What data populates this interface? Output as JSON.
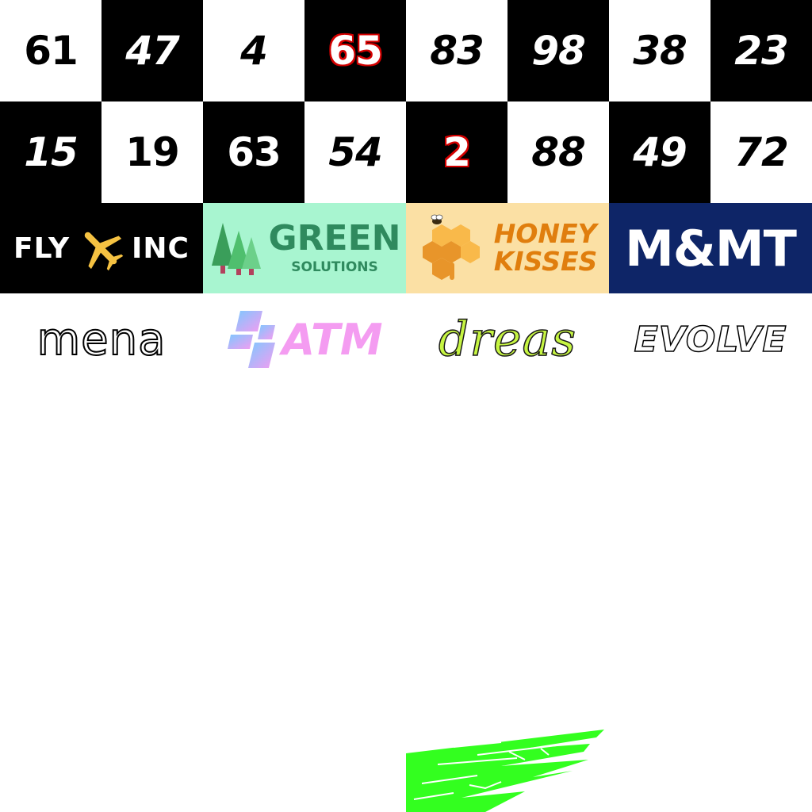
{
  "grid": {
    "rows": [
      [
        {
          "label": "61",
          "style": "light"
        },
        {
          "label": "47",
          "style": "dark",
          "italic": true
        },
        {
          "label": "4",
          "style": "light",
          "italic": true
        },
        {
          "label": "65",
          "style": "dark",
          "accent": true
        },
        {
          "label": "83",
          "style": "light",
          "italic": true
        },
        {
          "label": "98",
          "style": "dark",
          "italic": true
        },
        {
          "label": "38",
          "style": "light",
          "italic": true
        },
        {
          "label": "23",
          "style": "dark",
          "italic": true
        }
      ],
      [
        {
          "label": "15",
          "style": "dark",
          "italic": true
        },
        {
          "label": "19",
          "style": "light"
        },
        {
          "label": "63",
          "style": "dark"
        },
        {
          "label": "54",
          "style": "light",
          "italic": true
        },
        {
          "label": "2",
          "style": "dark",
          "accent": true
        },
        {
          "label": "88",
          "style": "light",
          "italic": true
        },
        {
          "label": "49",
          "style": "dark",
          "italic": true
        },
        {
          "label": "72",
          "style": "light",
          "italic": true
        }
      ]
    ]
  },
  "banners": {
    "fly": {
      "left": "FLY",
      "right": "INC",
      "icon": "airplane-icon"
    },
    "green": {
      "title": "GREEN",
      "subtitle": "SOLUTIONS",
      "icon": "pine-trees-icon"
    },
    "honey": {
      "line1": "HONEY",
      "line2": "KISSES",
      "icon": "honeycomb-bee-icon"
    },
    "mmt": {
      "title": "M&MT"
    }
  },
  "logos": {
    "mena": "mena",
    "atm": {
      "text": "ATM",
      "icon": "gradient-blocks-icon"
    },
    "dreas": "dreas",
    "evolve": "EVOLVE"
  },
  "colors": {
    "accent_red": "#d40000",
    "green_banner_bg": "#a8f5d0",
    "honey_banner_bg": "#fbe0a4",
    "mmt_banner_bg": "#0e2567",
    "plane_yellow": "#f5c242",
    "streak_green": "#33ff1f"
  }
}
